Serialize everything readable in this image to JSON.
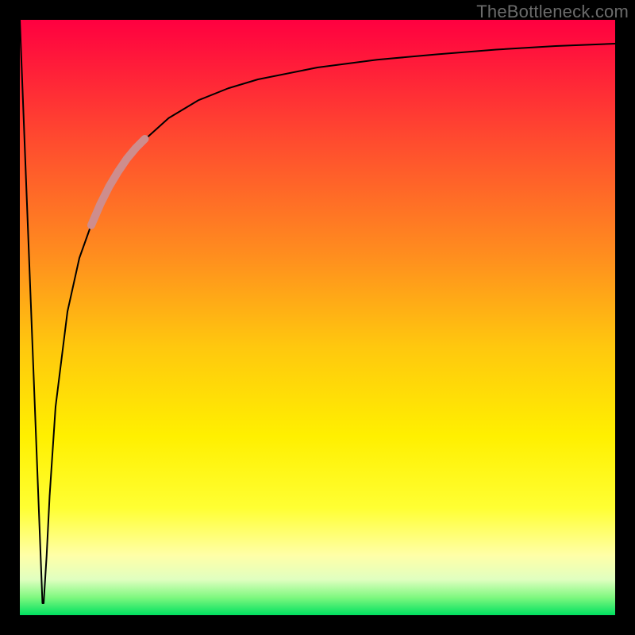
{
  "watermark": "TheBottleneck.com",
  "chart_data": {
    "type": "line",
    "title": "",
    "xlabel": "",
    "ylabel": "",
    "xlim": [
      0,
      100
    ],
    "ylim": [
      0,
      100
    ],
    "grid": false,
    "legend": false,
    "series": [
      {
        "name": "bottleneck-curve",
        "x": [
          0,
          3.8,
          4.0,
          4.5,
          5.0,
          6.0,
          8.0,
          10.0,
          12.5,
          15.0,
          17.5,
          20.0,
          25.0,
          30.0,
          35.0,
          40.0,
          50.0,
          60.0,
          70.0,
          80.0,
          90.0,
          100.0
        ],
        "y": [
          100,
          2,
          2,
          10,
          20,
          35,
          51,
          60,
          67,
          72,
          76,
          79,
          83.5,
          86.5,
          88.5,
          90,
          92,
          93.3,
          94.2,
          95,
          95.6,
          96
        ],
        "color": "#000000",
        "stroke_width": 2
      },
      {
        "name": "highlight-segment",
        "x": [
          12.0,
          13.5,
          15.0,
          16.5,
          18.0,
          19.5,
          21.0
        ],
        "y": [
          65.5,
          69.0,
          72.0,
          74.5,
          76.7,
          78.5,
          80.0
        ],
        "color": "#CE8D8D",
        "stroke_width": 10,
        "linecap": "round"
      }
    ],
    "background_gradient": {
      "type": "vertical",
      "stops": [
        {
          "offset": 0.0,
          "color": "#FF0040"
        },
        {
          "offset": 0.2,
          "color": "#FF4A2F"
        },
        {
          "offset": 0.4,
          "color": "#FF8F1E"
        },
        {
          "offset": 0.55,
          "color": "#FFC80E"
        },
        {
          "offset": 0.7,
          "color": "#FFF000"
        },
        {
          "offset": 0.82,
          "color": "#FFFF33"
        },
        {
          "offset": 0.9,
          "color": "#FFFFA8"
        },
        {
          "offset": 0.94,
          "color": "#E0FFC0"
        },
        {
          "offset": 0.97,
          "color": "#80F880"
        },
        {
          "offset": 1.0,
          "color": "#00E060"
        }
      ]
    }
  }
}
